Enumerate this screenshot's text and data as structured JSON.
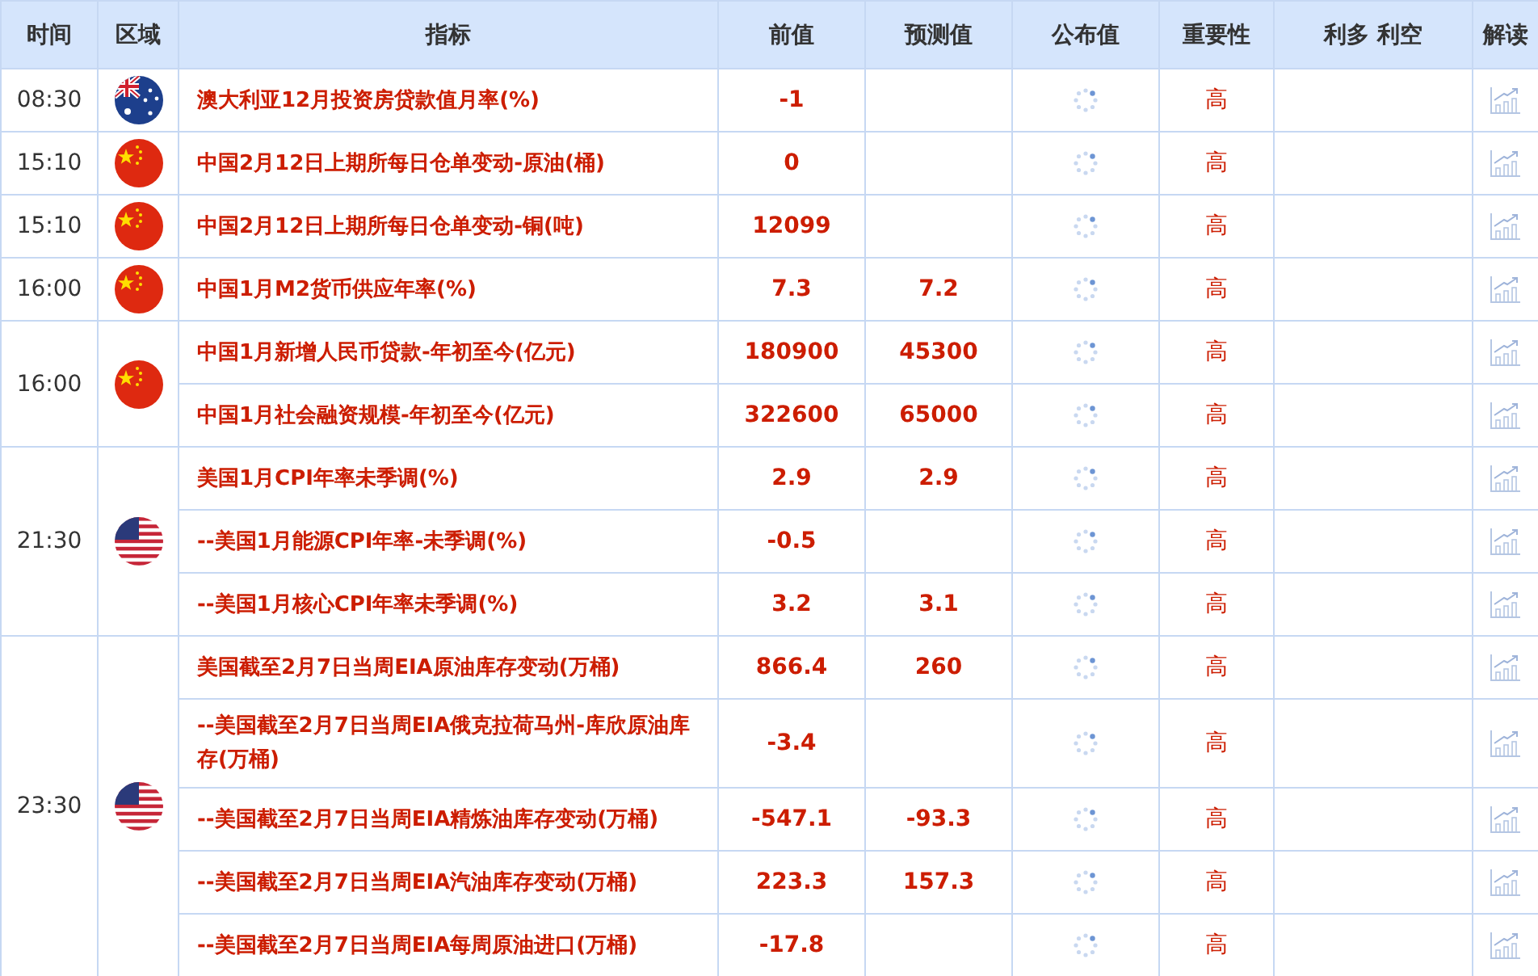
{
  "table": {
    "columns": [
      "时间",
      "区域",
      "指标",
      "前值",
      "预测值",
      "公布值",
      "重要性",
      "利多 利空",
      "解读"
    ],
    "groups": [
      {
        "time": "08:30",
        "kind": "australia",
        "rows": [
          {
            "indicator": "澳大利亚12月投资房贷款值月率(%)",
            "previous": "-1",
            "importance": "高"
          }
        ]
      },
      {
        "time": "15:10",
        "kind": "china",
        "rows": [
          {
            "indicator": "中国2月12日上期所每日仓单变动-原油(桶)",
            "previous": "0",
            "importance": "高"
          }
        ]
      },
      {
        "time": "15:10",
        "kind": "china",
        "rows": [
          {
            "indicator": "中国2月12日上期所每日仓单变动-铜(吨)",
            "previous": "12099",
            "importance": "高"
          }
        ]
      },
      {
        "time": "16:00",
        "kind": "china",
        "rows": [
          {
            "indicator": "中国1月M2货币供应年率(%)",
            "previous": "7.3",
            "forecast": "7.2",
            "importance": "高"
          }
        ]
      },
      {
        "time": "16:00",
        "kind": "china",
        "rows": [
          {
            "indicator": "中国1月新增人民币贷款-年初至今(亿元)",
            "previous": "180900",
            "forecast": "45300",
            "importance": "高"
          },
          {
            "indicator": "中国1月社会融资规模-年初至今(亿元)",
            "previous": "322600",
            "forecast": "65000",
            "importance": "高"
          }
        ]
      },
      {
        "time": "21:30",
        "kind": "usa",
        "rows": [
          {
            "indicator": "美国1月CPI年率未季调(%)",
            "previous": "2.9",
            "forecast": "2.9",
            "importance": "高"
          },
          {
            "indicator": "--美国1月能源CPI年率-未季调(%)",
            "previous": "-0.5",
            "importance": "高"
          },
          {
            "indicator": "--美国1月核心CPI年率未季调(%)",
            "previous": "3.2",
            "forecast": "3.1",
            "importance": "高"
          }
        ]
      },
      {
        "time": "23:30",
        "kind": "usa",
        "rows": [
          {
            "indicator": "美国截至2月7日当周EIA原油库存变动(万桶)",
            "previous": "866.4",
            "forecast": "260",
            "importance": "高"
          },
          {
            "indicator": "--美国截至2月7日当周EIA俄克拉荷马州-库欣原油库存(万桶)",
            "previous": "-3.4",
            "importance": "高"
          },
          {
            "indicator": "--美国截至2月7日当周EIA精炼油库存变动(万桶)",
            "previous": "-547.1",
            "forecast": "-93.3",
            "importance": "高"
          },
          {
            "indicator": "--美国截至2月7日当周EIA汽油库存变动(万桶)",
            "previous": "223.3",
            "forecast": "157.3",
            "importance": "高"
          },
          {
            "indicator": "--美国截至2月7日当周EIA每周原油进口(万桶)",
            "previous": "-17.8",
            "importance": "高"
          }
        ]
      }
    ]
  }
}
